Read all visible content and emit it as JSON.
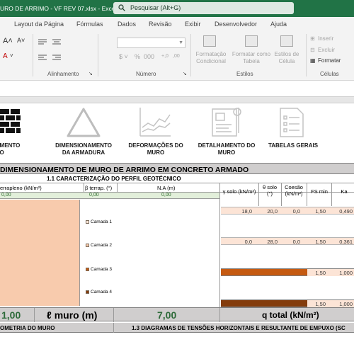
{
  "window": {
    "title": "URO DE ARRIMO - VF REV 07.xlsx  -  Excel",
    "search_placeholder": "Pesquisar (Alt+G)"
  },
  "ribbon_tabs": [
    "Layout da Página",
    "Fórmulas",
    "Dados",
    "Revisão",
    "Exibir",
    "Desenvolvedor",
    "Ajuda"
  ],
  "ribbon": {
    "groups": {
      "alinhamento": "Alinhamento",
      "numero": "Número",
      "estilos": "Estilos",
      "celulas": "Células"
    },
    "estilos": {
      "formatacao_condicional": "Formatação\nCondicional",
      "formatar_como_tabela": "Formatar como\nTabela",
      "estilos_de_celula": "Estilos de\nCélula"
    },
    "celulas": {
      "inserir": "Inserir",
      "excluir": "Excluir",
      "formatar": "Formatar"
    },
    "percent": "%"
  },
  "nav_icons": [
    {
      "label": "NAMENTO\nURO",
      "icon": "brick-wall-icon"
    },
    {
      "label": "DIMENSIONAMENTO\nDA ARMADURA",
      "icon": "triangle-icon"
    },
    {
      "label": "DEFORMAÇÕES DO\nMURO",
      "icon": "line-graph-icon"
    },
    {
      "label": "DETALHAMENTO DO\nMURO",
      "icon": "blueprint-icon"
    },
    {
      "label": "TABELAS GERAIS",
      "icon": "document-list-icon"
    }
  ],
  "sheet": {
    "main_title": "DIMENSIONAMENTO DE MURO DE ARRIMO EM CONCRETO ARMADO",
    "section_title": "1.1 CARACTERIZAÇÃO DO PERFIL GEOTÉCNICO",
    "headers": {
      "terrapleno": "errapleno (kN/m²)",
      "beta": "β terrap. (°)",
      "na": "N.A (m)",
      "gamma": "γ solo (kN/m³)",
      "theta": "θ solo\n(°)",
      "coesao": "Coesão\n(kN/m²)",
      "fs": "FS min",
      "ka": "Ka"
    },
    "green_values": [
      "0,00",
      "0,00",
      "0,00"
    ],
    "layers": [
      {
        "name": "Camada 1",
        "gamma": "18,0",
        "theta": "20,0",
        "coesao": "0,0",
        "fs": "1,50",
        "ka": "0,490"
      },
      {
        "name": "Camada 2",
        "gamma": "0,0",
        "theta": "28,0",
        "coesao": "0,0",
        "fs": "1,50",
        "ka": "0,361"
      },
      {
        "name": "Camada 3",
        "gamma": "",
        "theta": "",
        "coesao": "",
        "fs": "1,50",
        "ka": "1,000"
      },
      {
        "name": "Camada 4",
        "gamma": "",
        "theta": "",
        "coesao": "",
        "fs": "1,50",
        "ka": "1,000"
      }
    ],
    "bottom": {
      "value_left": "1,00",
      "label_muro": "ℓ muro (m)",
      "value_muro": "7,00",
      "label_q": "q total (kN/m²)"
    },
    "last_row": {
      "left": "OMETRIA DO MURO",
      "right": "1.3 DIAGRAMAS DE TENSÕES HORIZONTAIS E RESULTANTE DE EMPUXO (SC"
    }
  },
  "colors": {
    "excel_green": "#217346",
    "peach": "#f8cbad",
    "orange": "#c55a11",
    "brown": "#843c0c",
    "header_gray": "#d0cece",
    "light_green": "#e2efda"
  }
}
